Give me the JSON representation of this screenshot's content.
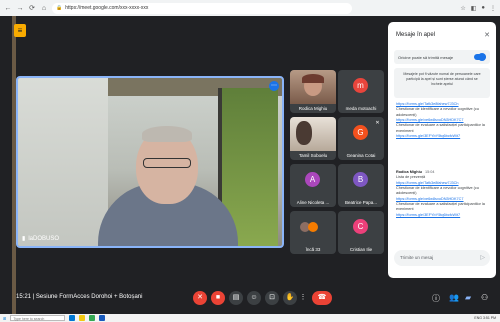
{
  "browser": {
    "url": "https://meet.google.com/xxx-xxxx-xxx",
    "icons": [
      "back-icon",
      "forward-icon",
      "reload-icon",
      "home-icon"
    ]
  },
  "meeting": {
    "time": "15:21",
    "title": "Sesiune FormAcces Dorohoi + Botoșani",
    "main_speaker": "laDOBUSO"
  },
  "tiles": [
    {
      "name": "Rodica Mighiu",
      "type": "photo"
    },
    {
      "name": "meda motoachi",
      "type": "avatar",
      "initial": "m",
      "color": "#e8453c"
    },
    {
      "name": "Tamil Soboelu",
      "type": "photo"
    },
    {
      "name": "Geanina Cotai",
      "type": "avatar",
      "initial": "G",
      "color": "#f4511e"
    },
    {
      "name": "Aline Nicoleta ...",
      "type": "avatar",
      "initial": "A",
      "color": "#ab47bc"
    },
    {
      "name": "Beatrice Papa...",
      "type": "avatar",
      "initial": "B",
      "color": "#7e57c2"
    },
    {
      "name": "Încă 33",
      "type": "more"
    },
    {
      "name": "Cristian Ilie",
      "type": "avatar",
      "initial": "C",
      "color": "#ec407a"
    }
  ],
  "chat": {
    "title": "Mesaje în apel",
    "toggle_label": "Oricine poate să trimită mesaje",
    "notice": "Mesajele pot fi văzute numai de persoanele care participă la apel și sunt șterse atunci când se încheie apelul",
    "message1_lines": [
      "https://forms.gle/Tafk3e8fahew7J3Ch",
      "Chestionar de identificare a nevoilor cognitive (cu adolescenți)",
      "https://forms.gle/xe6w8sxoDN3HDK7C7",
      "Chestionar de evaluare a satisfacției participantilor la eveniment",
      "https://forms.gle/3EFYbY5tq6bcfcWit7"
    ],
    "message2_author": "Rodica Mighiu",
    "message2_time": "15:04",
    "message2_lines": [
      "Lista de prezență",
      "https://forms.gle/Tafk3e8fahew7J3Ch",
      "Chestionar de identificare a nevoilor cognitive (cu adolescenți)",
      "https://forms.gle/xe6w8sxoDN3HDK7C7",
      "Chestionar de evaluare a satisfacției participantilor la eveniment",
      "https://forms.gle/3EFYbY5tq6bcfcWit7"
    ],
    "input_placeholder": "Trimite un mesaj"
  },
  "taskbar": {
    "search_placeholder": "Type here to search",
    "tray_text": "ENG 3:51 PM"
  }
}
